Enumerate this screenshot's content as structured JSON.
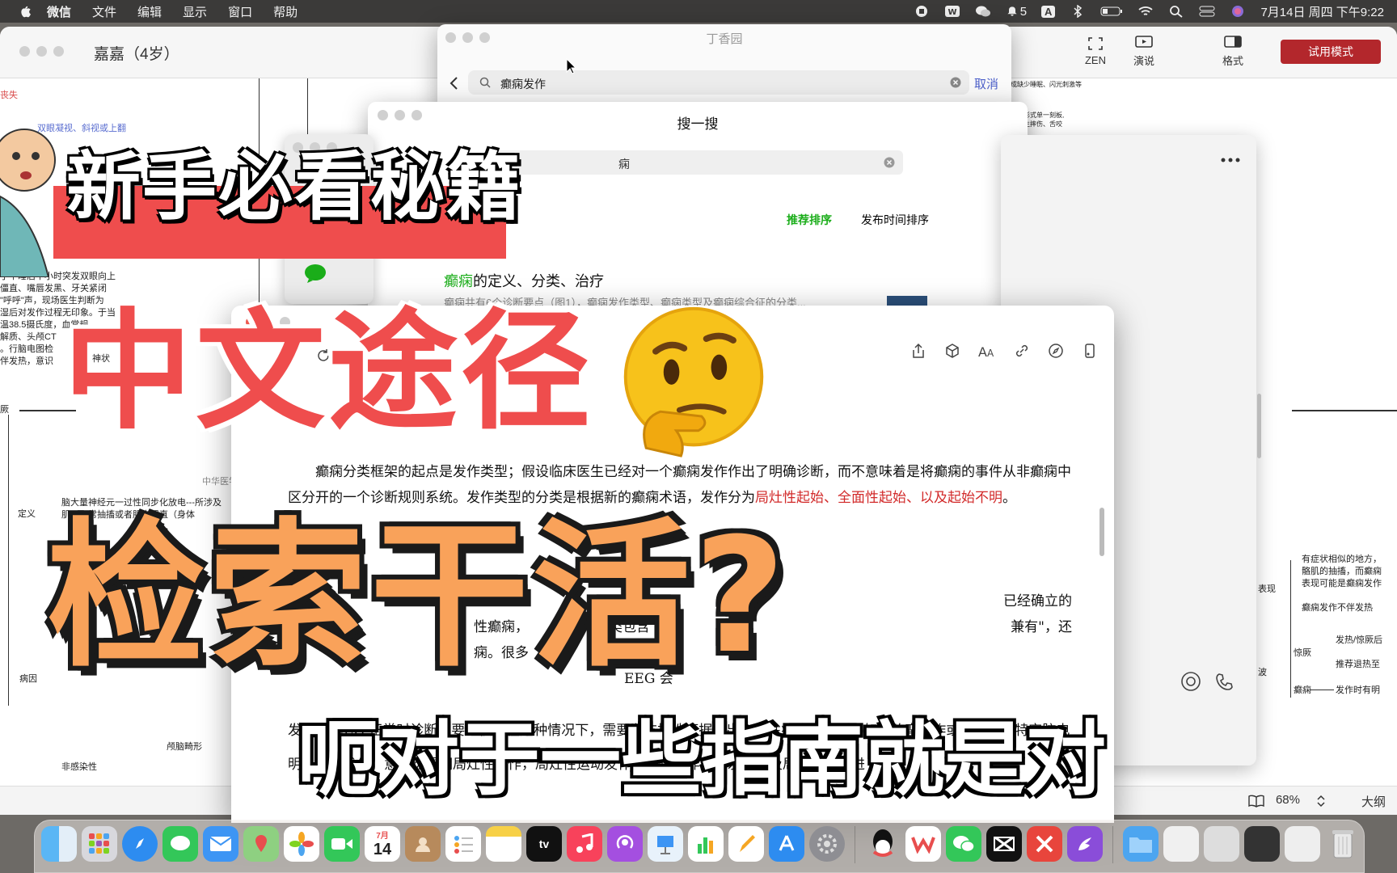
{
  "menubar": {
    "app_name": "微信",
    "menus": [
      "文件",
      "编辑",
      "显示",
      "窗口",
      "帮助"
    ],
    "notification_count": "5",
    "input_method": "A",
    "datetime": "7月14日 周四 下午9:22"
  },
  "doc_window": {
    "title": "嘉嘉（4岁）",
    "tools": [
      "ZEN",
      "演说",
      "格式"
    ],
    "trial_button": "试用模式",
    "zoom": "68%",
    "outline": "大纲",
    "mind_texts": {
      "t1": "丧失",
      "t2": "双眼凝视、斜视或上翻",
      "t3": "于午睡后半小时突发双眼向上\n僵直、嘴唇发黑、牙关紧闭\n\"呼呼\"声，现场医生判断为\n湿后对发作过程无印象。于当\n温38.5摄氏度，血常规\n解质、头颅CT\n。行脑电图检\n伴发热，意识",
      "t4": "神状",
      "t5": "厥",
      "t6": "定义",
      "t7": "脑大量神经元一过性同步化放电---所涉及\n肌不正常抽搐或者肌肉强直（身体",
      "t8": "病因",
      "t9": "颅脑畸形",
      "t10": "非感染性",
      "t11": "中华医学",
      "r1": "有症状相似的地方，\n骼肌的抽搐，而癫痫\n表现可能是癫痫发作",
      "r2": "表现",
      "r3": "癫痫发作不伴发热",
      "r4": "惊厥",
      "r5": "发热/惊厥后",
      "r6": "推荐退热至",
      "r7": "波",
      "r8": "癫痫",
      "r9": "发作时有明",
      "top1": "成缺少睡眠、闪光刺激等",
      "top2": "发作形式单一刻板,\n可发生摔伤、舌咬"
    }
  },
  "dxy_window": {
    "title": "丁香园",
    "search_value": "癫痫发作",
    "cancel": "取消"
  },
  "sys_window": {
    "title": "搜一搜",
    "search_value": "痫",
    "tabs": [
      "推荐排序",
      "发布时间排序"
    ],
    "result_title_hl": "癫痫",
    "result_title_rest": "的定义、分类、治疗",
    "result_snippet": "癫痫共有6个诊断要点（图1），癫痫发作类型、癫痫类型及癫痫综合征的分类..."
  },
  "reader": {
    "para1": "癫痫分类框架的起点是发作类型；假设临床医生已经对一个癫痫发作作出了明确诊断，而不意味着是将癫痫的事件从非癫痫中区分开的一个诊断规则系统。发作类型的分类是根据新的癫痫术语，发作分为",
    "para1_red": "局灶性起始、全面性起始、以及起始不明",
    "para1_end": "。",
    "para2a": "已经确立的",
    "para2b": "性癫痫，",
    "para2c": "分类包含",
    "para2d": "兼有\"，还",
    "para2e": "痫。很多",
    "para2f": "多种发作",
    "para2g": "EEG 会",
    "para3": "发作而 EEG 正常时诊断需要谨慎。在这种情况下，需要有支持性证据作出全面性癫痫的诊断，如肌阵挛发作或者相关的特定脑电",
    "para4": "明局灶性发作，意识觉醒明局灶性发作，局灶性运动发作，局灶性非运动发作以及局灶性发作进"
  },
  "captions": {
    "line1": "新手必看秘籍",
    "line2": "中文途径",
    "line3": "检索干活?",
    "subtitle": "呃对于一些指南就是对"
  },
  "dock": {
    "calendar_month": "7月",
    "calendar_day": "14",
    "apps": [
      "Finder",
      "Launchpad",
      "Safari",
      "Messages",
      "Mail",
      "Maps",
      "Photos",
      "FaceTime",
      "Calendar",
      "Contacts",
      "Reminders",
      "Notes",
      "TV",
      "Music",
      "Podcasts",
      "Keynote",
      "Numbers",
      "Pages",
      "App Store",
      "System Preferences",
      "QQ",
      "WPS",
      "WeChat",
      "CapCut",
      "XMind",
      "Craft",
      "Downloads",
      "Trash"
    ]
  },
  "colors": {
    "caption_red": "#ef4d4d",
    "caption_orange": "#f9a25a",
    "wechat_green": "#1aad19",
    "trial_red": "#b3272c",
    "cancel_blue": "#4c5fc9"
  }
}
